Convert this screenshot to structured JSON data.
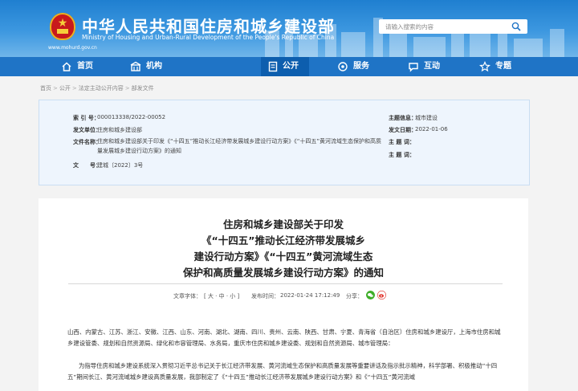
{
  "header": {
    "title": "中华人民共和国住房和城乡建设部",
    "subtitle": "Ministry of Housing and Urban-Rural Development of the People's Republic of China",
    "url": "www.mohurd.gov.cn",
    "search_placeholder": "请输入搜索的内容"
  },
  "nav": [
    {
      "label": "首页",
      "icon": "home-icon"
    },
    {
      "label": "机构",
      "icon": "institution-icon"
    },
    {
      "label": "公开",
      "icon": "document-icon"
    },
    {
      "label": "服务",
      "icon": "service-icon"
    },
    {
      "label": "互动",
      "icon": "chat-icon"
    },
    {
      "label": "专题",
      "icon": "topic-icon"
    }
  ],
  "breadcrumb": [
    "首页",
    "公开",
    "法定主动公开内容",
    "部发文件"
  ],
  "meta": {
    "index_label": "索 引 号：",
    "index_value": "000013338/2022-00052",
    "topic_label": "主题信息：",
    "topic_value": "城市建设",
    "issuer_label": "发文单位：",
    "issuer_value": "住房和城乡建设部",
    "date_label": "发文日期：",
    "date_value": "2022-01-06",
    "name_label": "文件名称：",
    "name_value": "住房和城乡建设部关于印发《“十四五”推动长江经济带发展城乡建设行动方案》《“十四五”黄河流域生态保护和高质量发展城乡建设行动方案》的通知",
    "category_label": "主 题 词：",
    "category_value": "",
    "docno_label": "文　　号：",
    "docno_value": "建城〔2022〕3号",
    "keyword_label": "主 题 词："
  },
  "article": {
    "title_lines": [
      "住房和城乡建设部关于印发",
      "《“十四五”推动长江经济带发展城乡",
      "建设行动方案》《“十四五”黄河流域生态",
      "保护和高质量发展城乡建设行动方案》的通知"
    ],
    "font_label": "文章字体：",
    "font_sizes": "[ 大 · 中 · 小 ]",
    "publish_label": "发布时间：",
    "publish_time": "2022-01-24 17:12:49",
    "share_label": "分享：",
    "para1": "山西、内蒙古、江苏、浙江、安徽、江西、山东、河南、湖北、湖南、四川、贵州、云南、陕西、甘肃、宁夏、青海省（自治区）住房和城乡建设厅，上海市住房和城乡建设管委、规划和自然资源局、绿化和市容管理局、水务局，重庆市住房和城乡建设委、规划和自然资源局、城市管理局：",
    "para2": "为指导住房和城乡建设系统深入贯彻习近平总书记关于长江经济带发展、黄河流域生态保护和高质量发展等重要讲话及指示批示精神，科学部署、积极推动“十四五”期间长江、黄河流域城乡建设高质量发展，我部制定了《“十四五”推动长江经济带发展城乡建设行动方案》和《“十四五”黄河流域"
  },
  "colors": {
    "header_blue": "#1f7fd0",
    "nav_blue": "#1f74c6",
    "nav_active": "#0d5eae",
    "meta_bg": "#eef5fd"
  }
}
